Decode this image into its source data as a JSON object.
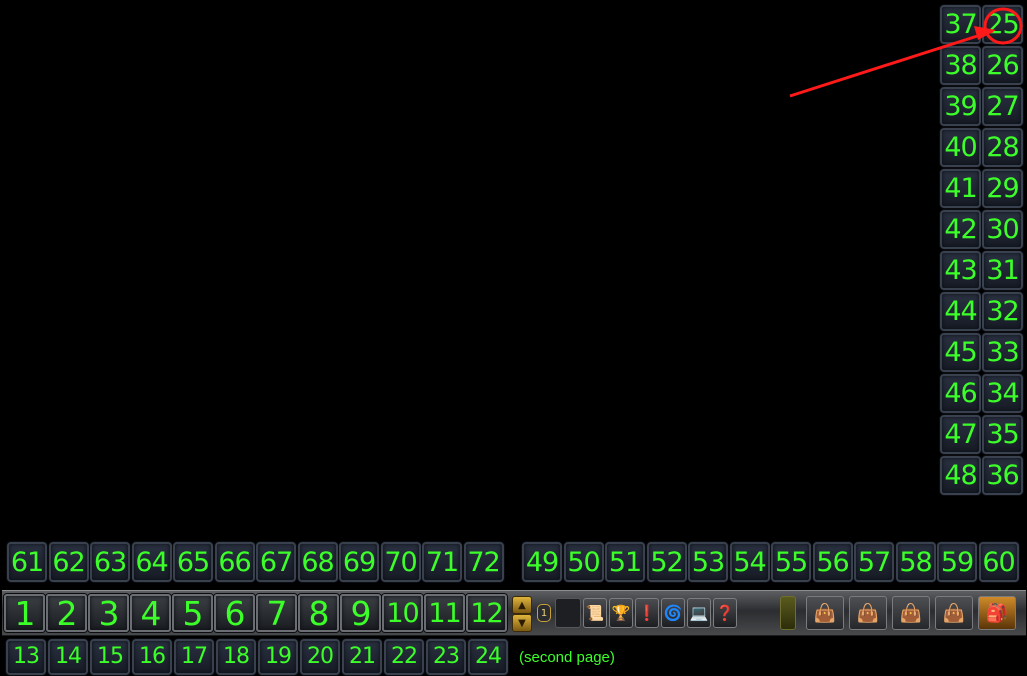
{
  "colors": {
    "label": "#3cff2a",
    "annotation": "#ff1a1a"
  },
  "right_bar_2": [
    "25",
    "26",
    "27",
    "28",
    "29",
    "30",
    "31",
    "32",
    "33",
    "34",
    "35",
    "36"
  ],
  "right_bar_1": [
    "37",
    "38",
    "39",
    "40",
    "41",
    "42",
    "43",
    "44",
    "45",
    "46",
    "47",
    "48"
  ],
  "bottom_left_bar": [
    "61",
    "62",
    "63",
    "64",
    "65",
    "66",
    "67",
    "68",
    "69",
    "70",
    "71",
    "72"
  ],
  "bottom_right_bar": [
    "49",
    "50",
    "51",
    "52",
    "53",
    "54",
    "55",
    "56",
    "57",
    "58",
    "59",
    "60"
  ],
  "main_bar": [
    "1",
    "2",
    "3",
    "4",
    "5",
    "6",
    "7",
    "8",
    "9",
    "10",
    "11",
    "12"
  ],
  "second_page": [
    "13",
    "14",
    "15",
    "16",
    "17",
    "18",
    "19",
    "20",
    "21",
    "22",
    "23",
    "24"
  ],
  "second_page_note": "(second page)",
  "page_buttons": {
    "up_icon": "chevron-up-icon",
    "down_icon": "chevron-down-icon",
    "page_number": "1"
  },
  "micro_menu": [
    {
      "name": "character-icon",
      "glyph": "📜"
    },
    {
      "name": "achievement-icon",
      "glyph": "🏆"
    },
    {
      "name": "quest-log-icon",
      "glyph": "❗"
    },
    {
      "name": "pvp-icon",
      "glyph": "🌀"
    },
    {
      "name": "socials-icon",
      "glyph": "💻"
    },
    {
      "name": "help-icon",
      "glyph": "❓"
    }
  ],
  "bag_slots": [
    {
      "name": "bag-slot-icon",
      "glyph": "👜"
    },
    {
      "name": "bag-slot-icon",
      "glyph": "👜"
    },
    {
      "name": "bag-slot-icon",
      "glyph": "👜"
    },
    {
      "name": "bag-slot-icon",
      "glyph": "👜"
    },
    {
      "name": "backpack-icon",
      "glyph": "🎒"
    }
  ]
}
